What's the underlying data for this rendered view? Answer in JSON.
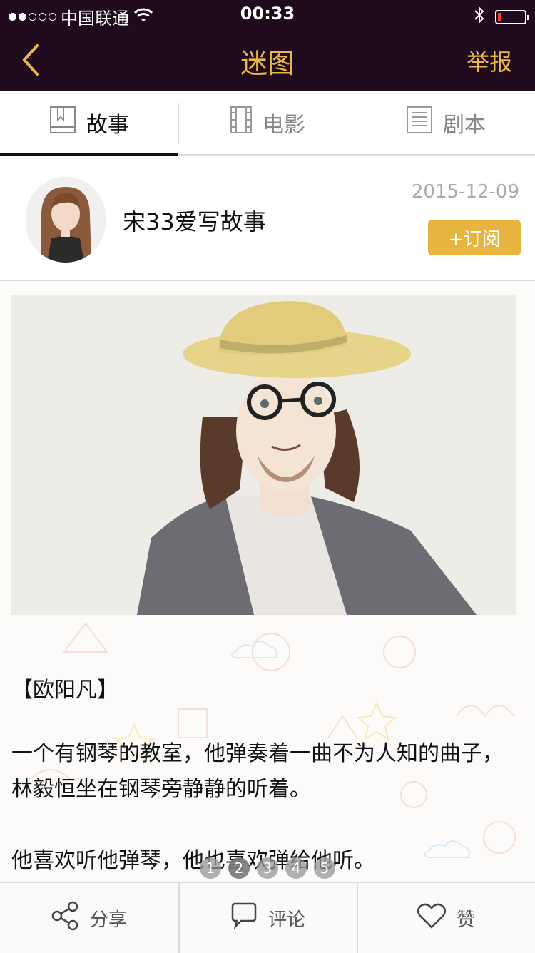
{
  "status_bar": {
    "carrier": "中国联通",
    "time": "00:33",
    "signal_filled": 2,
    "signal_total": 5,
    "battery_level": 0.15,
    "icons": [
      "wifi-icon",
      "bluetooth-icon",
      "battery-icon"
    ]
  },
  "nav": {
    "title": "迷图",
    "report_label": "举报",
    "back_icon": "chevron-left-icon",
    "accent_color": "#e8b84a",
    "background_color": "#200a1e"
  },
  "tabs": [
    {
      "label": "故事",
      "icon": "book-icon",
      "active": true
    },
    {
      "label": "电影",
      "icon": "film-icon",
      "active": false
    },
    {
      "label": "剧本",
      "icon": "script-icon",
      "active": false
    }
  ],
  "author": {
    "name": "宋33爱写故事",
    "date": "2015-12-09",
    "subscribe_label": "+订阅",
    "subscribe_color": "#e6b43f"
  },
  "story": {
    "title": "【欧阳凡】",
    "paragraphs": [
      "一个有钢琴的教室，他弹奏着一曲不为人知的曲子，林毅恒坐在钢琴旁静静的听着。",
      "他喜欢听他弹琴，他也喜欢弹给他听。"
    ]
  },
  "pager": {
    "pages": [
      "1",
      "2",
      "3",
      "4",
      "5"
    ],
    "current": 2
  },
  "bottom_bar": [
    {
      "label": "分享",
      "icon": "share-icon"
    },
    {
      "label": "评论",
      "icon": "comment-icon"
    },
    {
      "label": "赞",
      "icon": "heart-icon"
    }
  ]
}
